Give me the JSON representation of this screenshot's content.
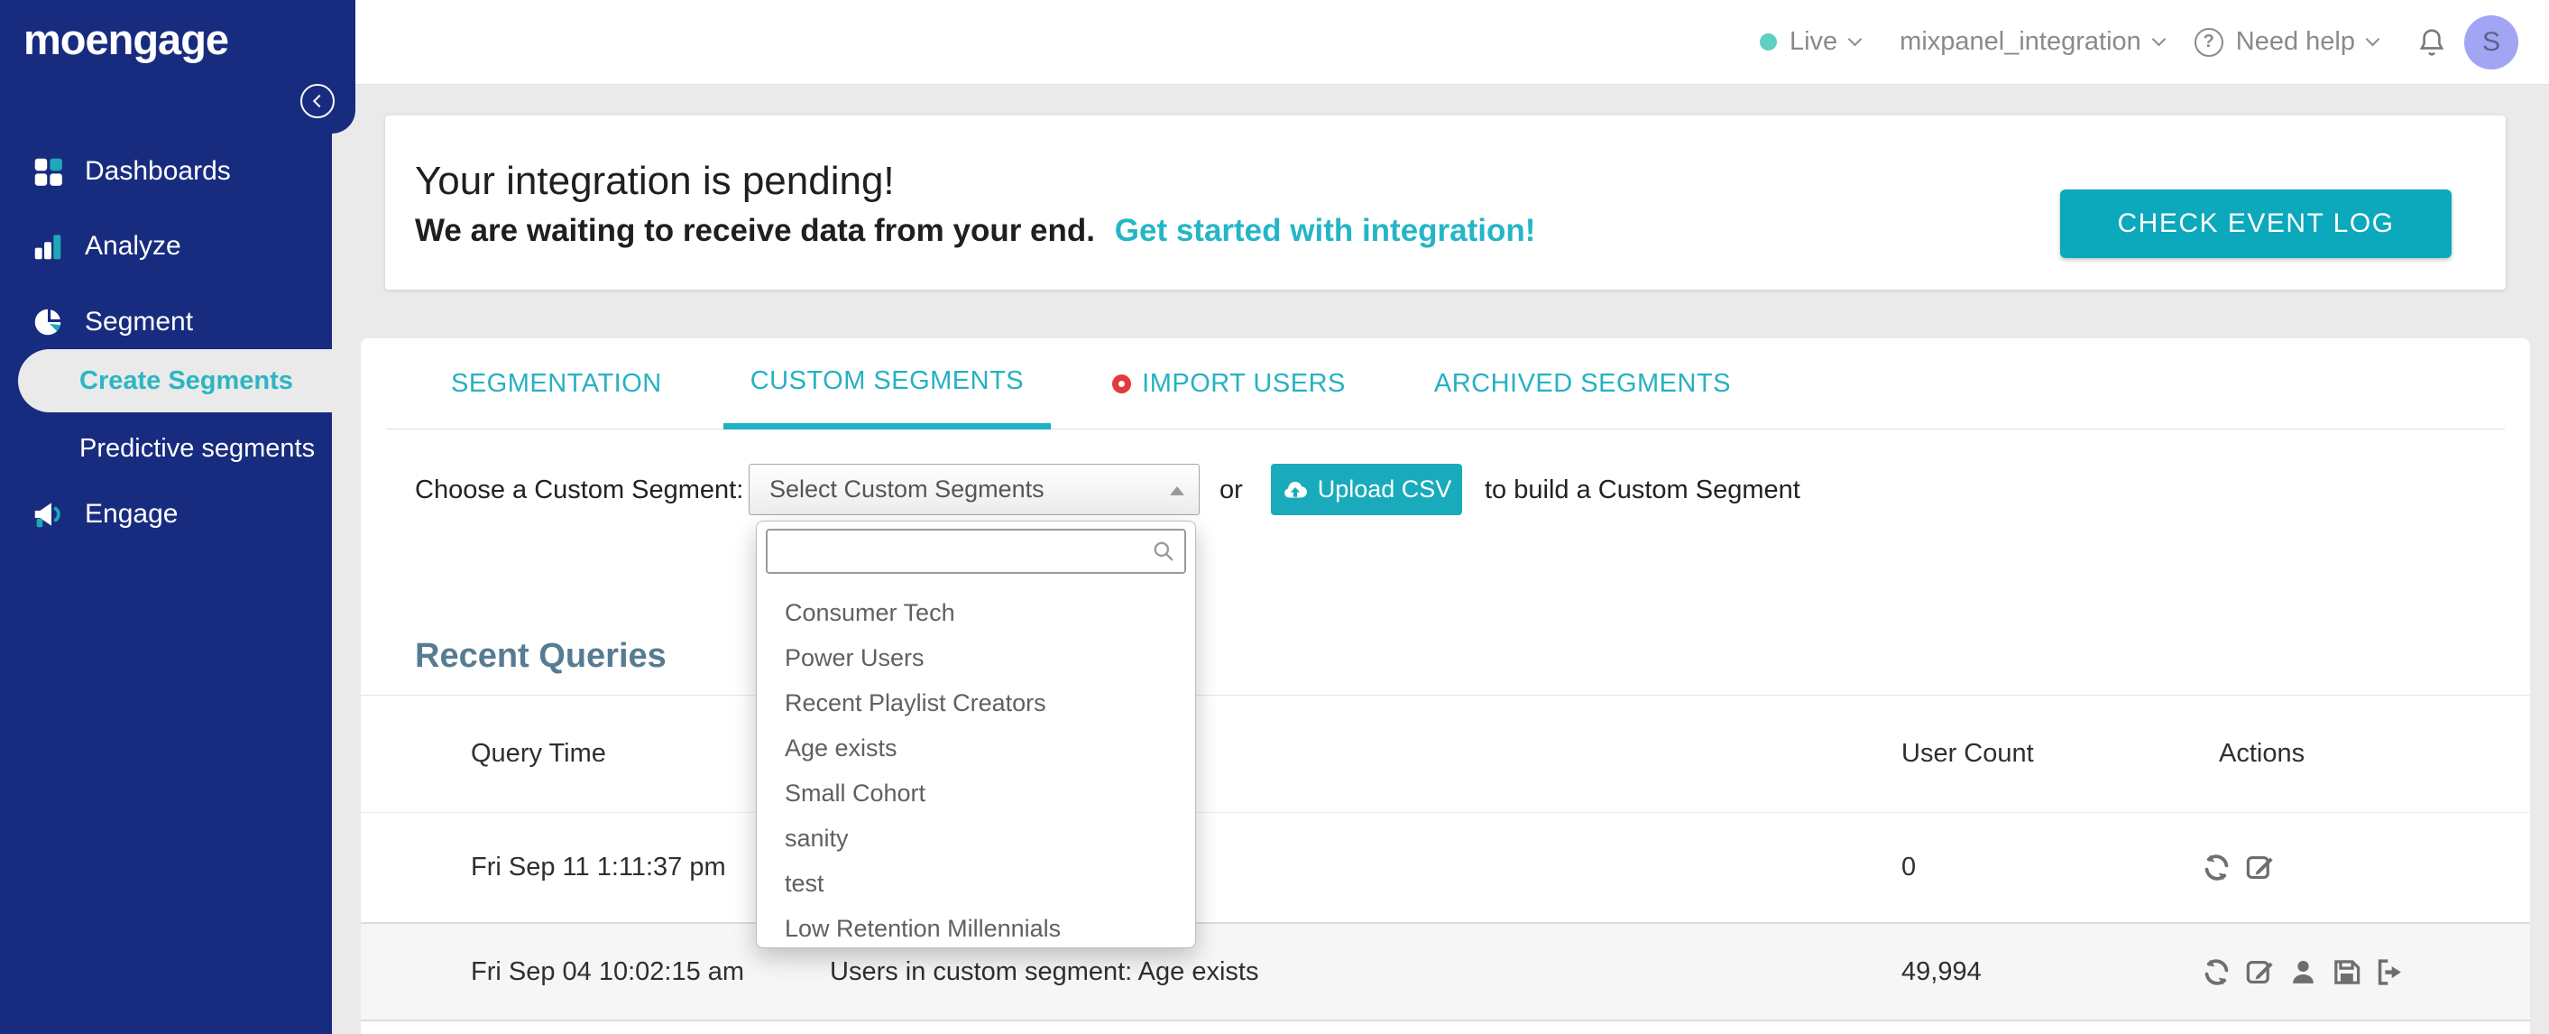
{
  "colors": {
    "sidebar_navy": "#182c7f",
    "accent_teal_text": "#25b1c2",
    "accent_teal_button": "#0ca8bb",
    "live_dot": "#5ecfc0",
    "avatar_bg": "#a2a5f3",
    "heading_slate": "#567c93",
    "main_bg": "#eaeaea",
    "row_alt_bg": "#f6f6f6"
  },
  "sidebar": {
    "logo": "moengage",
    "items": [
      {
        "label": "Dashboards",
        "icon": "dashboard-grid-icon"
      },
      {
        "label": "Analyze",
        "icon": "bar-chart-icon"
      },
      {
        "label": "Segment",
        "icon": "pie-chart-icon",
        "children": [
          {
            "label": "Create Segments",
            "active": true
          },
          {
            "label": "Predictive segments",
            "active": false
          }
        ]
      },
      {
        "label": "Engage",
        "icon": "megaphone-icon"
      }
    ]
  },
  "topbar": {
    "environment": "Live",
    "workspace": "mixpanel_integration",
    "help_label": "Need help",
    "avatar_initial": "S",
    "icons": [
      "live-dot",
      "chevron-down-icon",
      "question-icon",
      "bell-icon",
      "avatar"
    ]
  },
  "banner": {
    "title": "Your integration is pending!",
    "subtitle": "We are waiting to receive data from your end.",
    "link_label": "Get started with integration!",
    "button_label": "CHECK EVENT LOG"
  },
  "tabs": [
    {
      "label": "SEGMENTATION",
      "active": false
    },
    {
      "label": "CUSTOM SEGMENTS",
      "active": true
    },
    {
      "label": "IMPORT USERS",
      "active": false,
      "has_red_dot": true
    },
    {
      "label": "ARCHIVED SEGMENTS",
      "active": false
    }
  ],
  "segment_picker": {
    "label": "Choose a Custom Segment:",
    "select_value": "Select Custom Segments",
    "or_text": "or",
    "upload_button_label": "Upload CSV",
    "suffix_text": "to build a Custom Segment",
    "dropdown": {
      "search_value": "",
      "options": [
        "Consumer Tech",
        "Power Users",
        "Recent Playlist Creators",
        "Age exists",
        "Small Cohort",
        "sanity",
        "test",
        "Low Retention Millennials"
      ]
    }
  },
  "recent_queries": {
    "title": "Recent Queries",
    "columns": [
      "Query Time",
      "User Count",
      "Actions"
    ],
    "rows": [
      {
        "query_time": "Fri Sep 11 1:11:37 pm",
        "query_info": "",
        "user_count": "0",
        "actions": [
          "refresh",
          "edit"
        ]
      },
      {
        "query_time": "Fri Sep 04 10:02:15 am",
        "query_info": "Users in custom segment: Age exists",
        "user_count": "49,994",
        "actions": [
          "refresh",
          "edit",
          "user",
          "save",
          "export"
        ]
      }
    ]
  }
}
